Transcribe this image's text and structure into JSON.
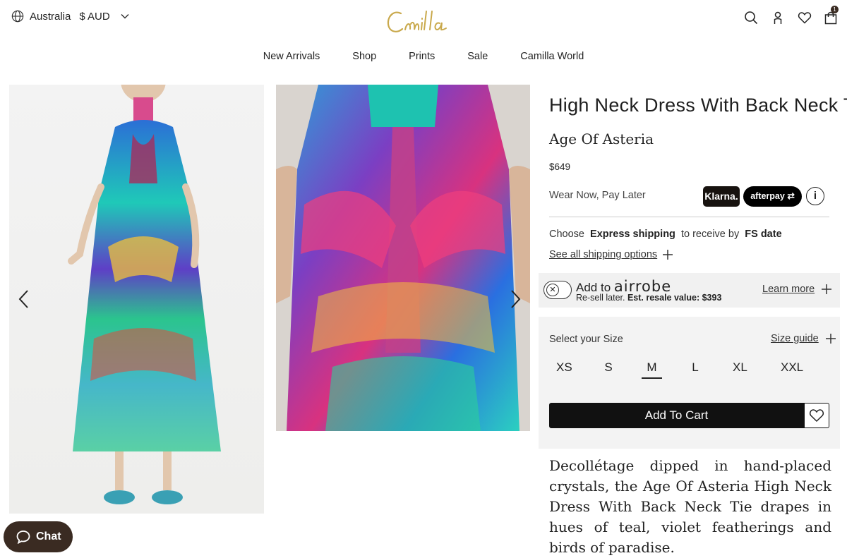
{
  "header": {
    "country": "Australia",
    "currency": "$ AUD",
    "logo_text": "Camilla",
    "cart_count": "1"
  },
  "nav": {
    "items": [
      "New Arrivals",
      "Shop",
      "Prints",
      "Sale",
      "Camilla World"
    ]
  },
  "product": {
    "title": "High Neck Dress With Back Neck Tie",
    "collection": "Age Of Asteria",
    "price": "$649",
    "pay_later": "Wear Now, Pay Later",
    "klarna_label": "Klarna.",
    "afterpay_label": "afterpay",
    "shipping": {
      "choose": "Choose",
      "express": "Express shipping",
      "to_receive": "to receive by",
      "date": "FS date",
      "see_all": "See all shipping options"
    },
    "airrobe": {
      "add_to": "Add to",
      "brand": "airrobe",
      "resell_text": "Re-sell later.",
      "resale_value_label": "Est. resale value: $393",
      "learn_more": "Learn more"
    },
    "sizes": {
      "label": "Select your Size",
      "guide": "Size guide",
      "options": [
        "XS",
        "S",
        "M",
        "L",
        "XL",
        "XXL"
      ],
      "selected": "M"
    },
    "add_to_cart": "Add To Cart",
    "description": "Decollétage dipped in hand-placed crystals, the Age Of Asteria High Neck Dress With Back Neck Tie drapes in hues of teal, violet featherings and birds of paradise."
  },
  "chat": {
    "label": "Chat"
  },
  "colors": {
    "brand_brown": "#3a2b22",
    "logo_gold": "#c9a94c",
    "panel_grey": "#f3f3f3"
  }
}
